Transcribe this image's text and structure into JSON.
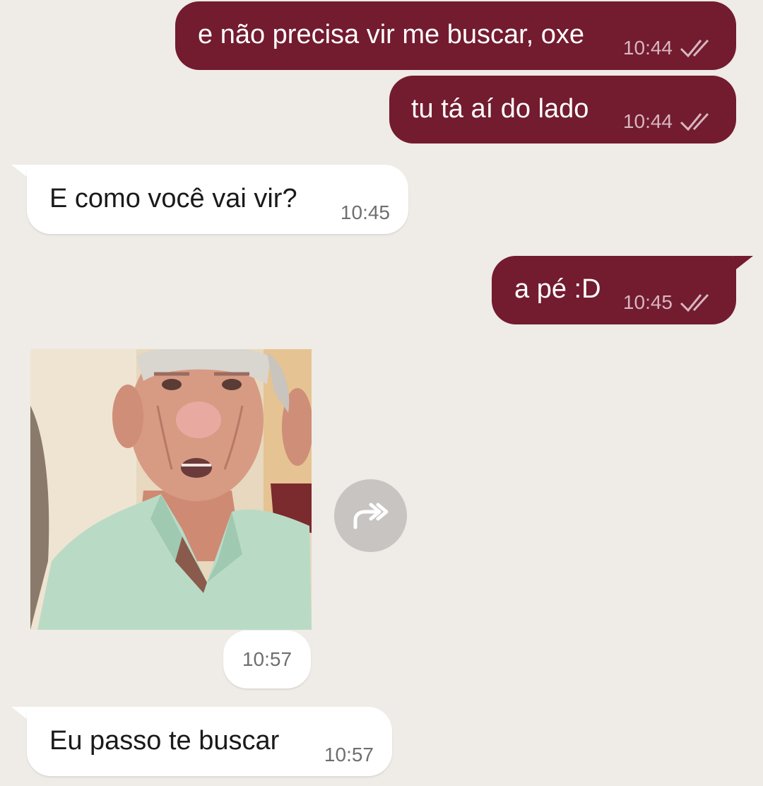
{
  "messages": [
    {
      "direction": "out",
      "text": "e não precisa vir me buscar, oxe",
      "time": "10:44",
      "status_icon": "double-check-icon"
    },
    {
      "direction": "out",
      "text": "tu tá aí do lado",
      "time": "10:44",
      "status_icon": "double-check-icon"
    },
    {
      "direction": "in",
      "text": "E como você vai vir?",
      "time": "10:45"
    },
    {
      "direction": "out",
      "text": "a pé :D",
      "time": "10:45",
      "status_icon": "double-check-icon"
    },
    {
      "direction": "in",
      "type": "sticker",
      "time": "10:57",
      "forward_icon": "forward-icon"
    },
    {
      "direction": "in",
      "text": "Eu passo te buscar",
      "time": "10:57"
    }
  ],
  "colors": {
    "background": "#efebe6",
    "outgoing_bubble": "#731b2f",
    "incoming_bubble": "#ffffff",
    "forward_button": "#c7c4c1"
  }
}
